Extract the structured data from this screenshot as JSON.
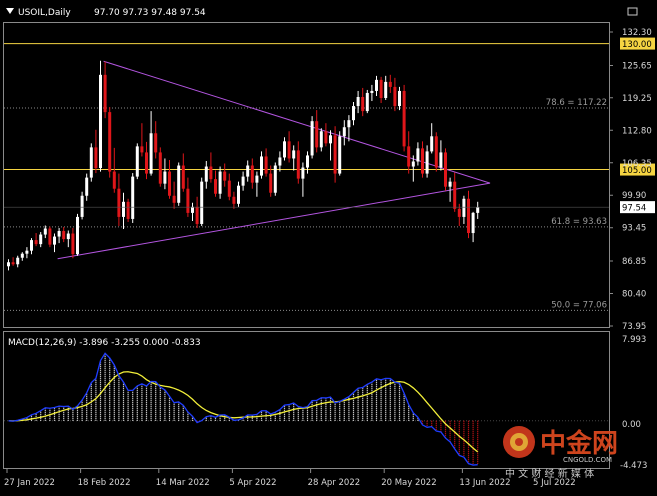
{
  "header": {
    "symbol_timeframe": "USOIL,Daily",
    "ohlc_text": "97.70 97.73 97.48 97.54"
  },
  "macd": {
    "label": "MACD(12,26,9) -3.896 -3.255 0.000 -0.833",
    "axis_top_label": "7.993",
    "axis_zero_label": "0.00",
    "axis_bottom_label": "-4.473"
  },
  "price_axis": {
    "tick_labels": [
      "132.30",
      "125.65",
      "119.25",
      "112.80",
      "106.35",
      "99.90",
      "93.45",
      "86.85",
      "80.40",
      "73.95"
    ],
    "tick_values": [
      132.3,
      125.65,
      119.25,
      112.8,
      106.35,
      99.9,
      93.45,
      86.85,
      80.4,
      73.95
    ],
    "range": [
      73.95,
      132.3
    ]
  },
  "levels": [
    {
      "label": "130.00",
      "value": 130.0,
      "kind": "yellow-line",
      "color": "#f5d442"
    },
    {
      "label": "105.00",
      "value": 105.0,
      "kind": "yellow-line",
      "color": "#f5d442"
    },
    {
      "label": "78.6 = 117.22",
      "value": 117.22,
      "kind": "fib"
    },
    {
      "label": "61.8 = 93.63",
      "value": 93.63,
      "kind": "fib"
    },
    {
      "label": "50.0 = 77.06",
      "value": 77.06,
      "kind": "fib"
    }
  ],
  "current_price": {
    "label": "97.54",
    "value": 97.54
  },
  "date_axis": {
    "labels": [
      "27 Jan 2022",
      "18 Feb 2022",
      "14 Mar 2022",
      "5 Apr 2022",
      "28 Apr 2022",
      "20 May 2022",
      "13 Jun 2022",
      "5 Jul 2022"
    ]
  },
  "watermark": {
    "brand": "中金网",
    "domain": "CNGOLD.COM",
    "tagline": "中 文 财 经 新 媒 体"
  },
  "colors": {
    "bull": "#ffffff",
    "bear": "#e0161a",
    "triangle": "#b355e0",
    "macd_main": "#f2ef3a",
    "macd_signal": "#1f3dff",
    "hist_pos": "#ffffff",
    "hist_neg": "#e0161a"
  },
  "chart_data": {
    "type": "candlestick",
    "title": "USOIL,Daily",
    "date_labels": [
      "27 Jan 2022",
      "18 Feb 2022",
      "14 Mar 2022",
      "5 Apr 2022",
      "28 Apr 2022",
      "20 May 2022",
      "13 Jun 2022",
      "5 Jul 2022"
    ],
    "date_label_bar_index": [
      0,
      16,
      33,
      49,
      66,
      82,
      99,
      115
    ],
    "ylim": [
      73.95,
      132.3
    ],
    "triangle": {
      "upper_start": [
        21,
        126.5
      ],
      "apex": [
        105,
        102.3
      ],
      "lower_start": [
        11,
        87.3
      ]
    },
    "ohlc": [
      [
        85.8,
        87.2,
        85.0,
        86.6
      ],
      [
        86.6,
        87.6,
        85.9,
        86.2
      ],
      [
        86.2,
        87.9,
        85.6,
        87.5
      ],
      [
        87.5,
        88.6,
        86.9,
        88.3
      ],
      [
        88.3,
        89.6,
        87.4,
        88.9
      ],
      [
        88.9,
        91.4,
        88.2,
        91.0
      ],
      [
        91.0,
        92.4,
        89.8,
        90.2
      ],
      [
        90.2,
        92.6,
        89.6,
        92.1
      ],
      [
        92.1,
        93.9,
        91.4,
        93.3
      ],
      [
        93.3,
        93.7,
        89.6,
        90.1
      ],
      [
        90.1,
        92.3,
        88.6,
        91.7
      ],
      [
        91.7,
        93.4,
        90.4,
        92.8
      ],
      [
        92.8,
        93.6,
        90.6,
        91.2
      ],
      [
        91.2,
        92.9,
        89.6,
        92.3
      ],
      [
        92.3,
        93.4,
        87.4,
        88.2
      ],
      [
        88.2,
        96.2,
        87.9,
        95.6
      ],
      [
        95.6,
        100.6,
        95.1,
        99.8
      ],
      [
        99.8,
        104.2,
        98.8,
        103.4
      ],
      [
        103.4,
        110.2,
        102.6,
        109.4
      ],
      [
        109.4,
        112.9,
        104.3,
        105.3
      ],
      [
        105.3,
        126.6,
        104.6,
        123.8
      ],
      [
        123.8,
        126.4,
        115.2,
        116.4
      ],
      [
        116.4,
        117.4,
        103.4,
        104.6
      ],
      [
        104.6,
        109.3,
        100.4,
        101.2
      ],
      [
        101.2,
        104.2,
        93.8,
        95.6
      ],
      [
        95.6,
        100.4,
        93.2,
        98.6
      ],
      [
        98.6,
        99.2,
        94.6,
        95.2
      ],
      [
        95.2,
        104.3,
        94.4,
        103.6
      ],
      [
        103.6,
        110.2,
        103.1,
        109.6
      ],
      [
        109.6,
        114.2,
        107.6,
        108.4
      ],
      [
        108.4,
        110.5,
        103.1,
        104.2
      ],
      [
        104.2,
        116.6,
        103.8,
        112.2
      ],
      [
        112.2,
        114.6,
        107.2,
        108.4
      ],
      [
        108.4,
        109.4,
        101.6,
        102.2
      ],
      [
        102.2,
        107.2,
        101.1,
        104.6
      ],
      [
        104.6,
        106.9,
        99.2,
        99.8
      ],
      [
        99.8,
        102.6,
        97.2,
        98.4
      ],
      [
        98.4,
        106.4,
        97.8,
        105.8
      ],
      [
        105.8,
        108.2,
        100.6,
        101.2
      ],
      [
        101.2,
        103.4,
        95.6,
        96.4
      ],
      [
        96.4,
        98.4,
        94.8,
        97.6
      ],
      [
        97.6,
        99.6,
        93.4,
        94.2
      ],
      [
        94.2,
        103.4,
        93.8,
        102.6
      ],
      [
        102.6,
        106.7,
        101.2,
        105.6
      ],
      [
        105.6,
        108.4,
        102.4,
        103.1
      ],
      [
        103.1,
        104.8,
        99.6,
        100.2
      ],
      [
        100.2,
        105.6,
        99.2,
        104.6
      ],
      [
        104.6,
        106.2,
        101.6,
        102.8
      ],
      [
        102.8,
        104.2,
        98.9,
        99.6
      ],
      [
        99.6,
        100.6,
        97.2,
        98.2
      ],
      [
        98.2,
        102.6,
        97.6,
        101.8
      ],
      [
        101.8,
        104.6,
        100.8,
        103.6
      ],
      [
        103.6,
        106.8,
        102.6,
        105.8
      ],
      [
        105.8,
        107.2,
        101.2,
        102.4
      ],
      [
        102.4,
        104.6,
        99.6,
        103.8
      ],
      [
        103.8,
        108.6,
        103.2,
        107.6
      ],
      [
        107.6,
        109.2,
        103.6,
        104.2
      ],
      [
        104.2,
        105.8,
        99.6,
        100.4
      ],
      [
        100.4,
        106.4,
        99.8,
        105.8
      ],
      [
        105.8,
        108.6,
        104.6,
        107.4
      ],
      [
        107.4,
        111.4,
        106.8,
        110.6
      ],
      [
        110.6,
        112.6,
        106.4,
        107.2
      ],
      [
        107.2,
        109.8,
        104.8,
        108.8
      ],
      [
        108.8,
        110.6,
        102.2,
        103.2
      ],
      [
        103.2,
        106.4,
        99.6,
        105.4
      ],
      [
        105.4,
        108.6,
        104.2,
        107.8
      ],
      [
        107.8,
        115.6,
        107.2,
        114.6
      ],
      [
        114.6,
        116.8,
        108.4,
        109.4
      ],
      [
        109.4,
        113.2,
        108.6,
        112.6
      ],
      [
        112.6,
        114.2,
        109.6,
        110.2
      ],
      [
        110.2,
        112.8,
        106.8,
        111.8
      ],
      [
        111.8,
        113.6,
        102.4,
        104.2
      ],
      [
        104.2,
        112.6,
        103.8,
        111.6
      ],
      [
        111.6,
        114.8,
        109.8,
        113.4
      ],
      [
        113.4,
        115.8,
        110.6,
        114.8
      ],
      [
        114.8,
        118.4,
        113.8,
        117.6
      ],
      [
        117.6,
        120.6,
        116.2,
        119.4
      ],
      [
        119.4,
        121.2,
        115.6,
        116.6
      ],
      [
        116.6,
        120.8,
        116.2,
        120.2
      ],
      [
        120.2,
        121.8,
        118.6,
        120.6
      ],
      [
        120.6,
        123.6,
        119.6,
        122.8
      ],
      [
        122.8,
        123.4,
        118.2,
        119.2
      ],
      [
        119.2,
        123.6,
        118.8,
        122.4
      ],
      [
        122.4,
        123.8,
        120.2,
        121.4
      ],
      [
        121.4,
        123.2,
        116.6,
        117.6
      ],
      [
        117.6,
        121.4,
        116.8,
        120.6
      ],
      [
        120.6,
        121.8,
        108.6,
        109.6
      ],
      [
        109.6,
        112.6,
        104.2,
        105.6
      ],
      [
        105.6,
        107.8,
        102.6,
        106.6
      ],
      [
        106.6,
        110.4,
        105.8,
        109.2
      ],
      [
        109.2,
        110.6,
        103.4,
        104.2
      ],
      [
        104.2,
        109.8,
        103.4,
        108.6
      ],
      [
        108.6,
        114.2,
        108.2,
        111.6
      ],
      [
        111.6,
        112.4,
        104.6,
        105.4
      ],
      [
        105.4,
        110.8,
        104.8,
        108.4
      ],
      [
        108.4,
        109.2,
        100.8,
        101.6
      ],
      [
        101.6,
        103.4,
        98.6,
        102.6
      ],
      [
        102.6,
        104.4,
        96.6,
        97.2
      ],
      [
        97.2,
        98.2,
        93.8,
        95.6
      ],
      [
        95.6,
        99.8,
        94.2,
        99.2
      ],
      [
        99.2,
        100.8,
        91.4,
        92.4
      ],
      [
        92.4,
        96.6,
        90.6,
        96.4
      ],
      [
        96.4,
        98.6,
        95.2,
        97.54
      ]
    ]
  }
}
